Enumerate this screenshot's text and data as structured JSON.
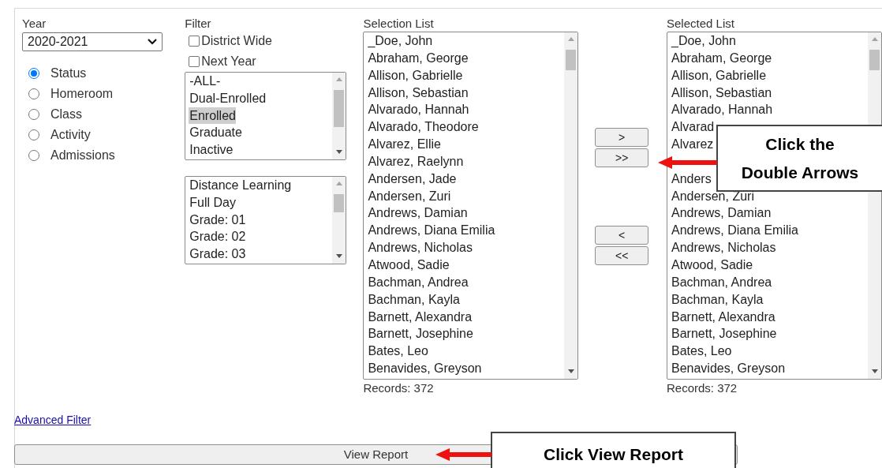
{
  "year": {
    "label": "Year",
    "value": "2020-2021"
  },
  "group_by": [
    {
      "label": "Status",
      "selected": true
    },
    {
      "label": "Homeroom",
      "selected": false
    },
    {
      "label": "Class",
      "selected": false
    },
    {
      "label": "Activity",
      "selected": false
    },
    {
      "label": "Admissions",
      "selected": false
    }
  ],
  "filter": {
    "label": "Filter",
    "checkboxes": [
      {
        "label": "District Wide",
        "checked": false
      },
      {
        "label": "Next Year",
        "checked": false
      }
    ],
    "status_list": [
      {
        "label": "-ALL-",
        "selected": false
      },
      {
        "label": "Dual-Enrolled",
        "selected": false
      },
      {
        "label": "Enrolled",
        "selected": true
      },
      {
        "label": "Graduate",
        "selected": false
      },
      {
        "label": "Inactive",
        "selected": false
      }
    ],
    "program_list": [
      {
        "label": "Distance Learning",
        "selected": false
      },
      {
        "label": "Full Day",
        "selected": false
      },
      {
        "label": "Grade: 01",
        "selected": false
      },
      {
        "label": "Grade: 02",
        "selected": false
      },
      {
        "label": "Grade: 03",
        "selected": false
      }
    ]
  },
  "selection_list": {
    "label": "Selection List",
    "records": "Records: 372",
    "items": [
      "_Doe, John",
      "Abraham, George",
      "Allison, Gabrielle",
      "Allison, Sebastian",
      "Alvarado, Hannah",
      "Alvarado, Theodore",
      "Alvarez, Ellie",
      "Alvarez, Raelynn",
      "Andersen, Jade",
      "Andersen, Zuri",
      "Andrews, Damian",
      "Andrews, Diana Emilia",
      "Andrews, Nicholas",
      "Atwood, Sadie",
      "Bachman, Andrea",
      "Bachman, Kayla",
      "Barnett, Alexandra",
      "Barnett, Josephine",
      "Bates, Leo",
      "Benavides, Greyson"
    ]
  },
  "move_buttons": [
    ">",
    ">>",
    "<",
    "<<"
  ],
  "selected_list": {
    "label": "Selected List",
    "records": "Records: 372",
    "items": [
      "_Doe, John",
      "Abraham, George",
      "Allison, Gabrielle",
      "Allison, Sebastian",
      "Alvarado, Hannah",
      "Alvarad",
      "Alvarez"
    ],
    "items_below_arrow": [
      "Anders",
      "Andersen, Zuri",
      "Andrews, Damian",
      "Andrews, Diana Emilia",
      "Andrews, Nicholas",
      "Atwood, Sadie",
      "Bachman, Andrea",
      "Bachman, Kayla",
      "Barnett, Alexandra",
      "Barnett, Josephine",
      "Bates, Leo",
      "Benavides, Greyson"
    ]
  },
  "advanced_filter_link": "Advanced Filter",
  "view_report_button": "View Report",
  "callouts": [
    "Click the\nDouble Arrows",
    "Click View Report"
  ]
}
